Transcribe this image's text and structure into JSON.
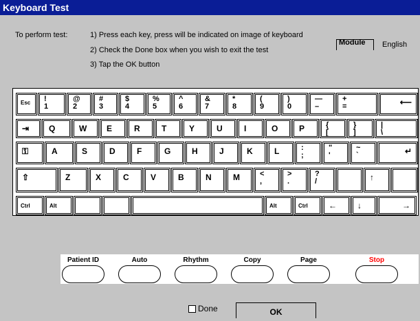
{
  "window": {
    "title": "Keyboard Test"
  },
  "instructions": {
    "lead": "To perform test:",
    "step1": "1) Press each key, press will be indicated on image of keyboard",
    "step2": "2) Check the Done box when you wish to exit the test",
    "step3": "3) Tap the OK button"
  },
  "module": {
    "label": "Module",
    "language": "English"
  },
  "keyboard": {
    "row1": [
      {
        "name": "esc",
        "small": "Esc"
      },
      {
        "name": "1",
        "top": "!",
        "bot": "1"
      },
      {
        "name": "2",
        "top": "@",
        "bot": "2"
      },
      {
        "name": "3",
        "top": "#",
        "bot": "3"
      },
      {
        "name": "4",
        "top": "$",
        "bot": "4"
      },
      {
        "name": "5",
        "top": "%",
        "bot": "5"
      },
      {
        "name": "6",
        "top": "^",
        "bot": "6"
      },
      {
        "name": "7",
        "top": "&",
        "bot": "7"
      },
      {
        "name": "8",
        "top": "*",
        "bot": "8"
      },
      {
        "name": "9",
        "top": "(",
        "bot": "9"
      },
      {
        "name": "0",
        "top": ")",
        "bot": "0"
      },
      {
        "name": "minus",
        "top": "—",
        "bot": "–"
      },
      {
        "name": "equals",
        "top": "+",
        "bot": "="
      },
      {
        "name": "backspace",
        "icon": "⟵"
      }
    ],
    "row2": [
      {
        "name": "tab",
        "icon": "⇥"
      },
      {
        "name": "q",
        "main": "Q"
      },
      {
        "name": "w",
        "main": "W"
      },
      {
        "name": "e",
        "main": "E"
      },
      {
        "name": "r",
        "main": "R"
      },
      {
        "name": "t",
        "main": "T"
      },
      {
        "name": "y",
        "main": "Y"
      },
      {
        "name": "u",
        "main": "U"
      },
      {
        "name": "i",
        "main": "I"
      },
      {
        "name": "o",
        "main": "O"
      },
      {
        "name": "p",
        "main": "P"
      },
      {
        "name": "lbracket",
        "top": "{",
        "bot": "["
      },
      {
        "name": "rbracket",
        "top": "}",
        "bot": "]"
      },
      {
        "name": "backslash",
        "top": "|",
        "bot": "\\"
      }
    ],
    "row3": [
      {
        "name": "caps",
        "icon": "⚿"
      },
      {
        "name": "a",
        "main": "A"
      },
      {
        "name": "s",
        "main": "S"
      },
      {
        "name": "d",
        "main": "D"
      },
      {
        "name": "f",
        "main": "F"
      },
      {
        "name": "g",
        "main": "G"
      },
      {
        "name": "h",
        "main": "H"
      },
      {
        "name": "j",
        "main": "J"
      },
      {
        "name": "k",
        "main": "K"
      },
      {
        "name": "l",
        "main": "L"
      },
      {
        "name": "semicolon",
        "top": ":",
        "bot": ";"
      },
      {
        "name": "quote",
        "top": "\"",
        "bot": "'"
      },
      {
        "name": "tilde",
        "top": "~",
        "bot": "`"
      },
      {
        "name": "enter",
        "icon": "↵"
      }
    ],
    "row4": [
      {
        "name": "shift",
        "icon": "⇧"
      },
      {
        "name": "z",
        "main": "Z"
      },
      {
        "name": "x",
        "main": "X"
      },
      {
        "name": "c",
        "main": "C"
      },
      {
        "name": "v",
        "main": "V"
      },
      {
        "name": "b",
        "main": "B"
      },
      {
        "name": "n",
        "main": "N"
      },
      {
        "name": "m",
        "main": "M"
      },
      {
        "name": "comma",
        "top": "<",
        "bot": ","
      },
      {
        "name": "period",
        "top": ">",
        "bot": "."
      },
      {
        "name": "slash",
        "top": "?",
        "bot": "/"
      },
      {
        "name": "blank4"
      },
      {
        "name": "up",
        "icon": "↑"
      },
      {
        "name": "blank4b"
      }
    ],
    "row5": [
      {
        "name": "ctrl-left",
        "small": "Ctrl"
      },
      {
        "name": "alt-left",
        "small": "Alt"
      },
      {
        "name": "blank5a"
      },
      {
        "name": "blank5b"
      },
      {
        "name": "space"
      },
      {
        "name": "alt-right",
        "small": "Alt"
      },
      {
        "name": "ctrl-right",
        "small": "Ctrl"
      },
      {
        "name": "left",
        "icon": "←"
      },
      {
        "name": "down",
        "icon": "↓"
      },
      {
        "name": "right",
        "icon": "→"
      }
    ]
  },
  "function_buttons": [
    {
      "name": "patient-id",
      "label": "Patient ID",
      "color": "#000000"
    },
    {
      "name": "auto",
      "label": "Auto",
      "color": "#000000"
    },
    {
      "name": "rhythm",
      "label": "Rhythm",
      "color": "#000000"
    },
    {
      "name": "copy",
      "label": "Copy",
      "color": "#000000"
    },
    {
      "name": "page",
      "label": "Page",
      "color": "#000000"
    },
    {
      "name": "stop",
      "label": "Stop",
      "color": "#ff0000"
    }
  ],
  "footer": {
    "done_label": "Done",
    "done_checked": false,
    "ok_label": "OK"
  }
}
